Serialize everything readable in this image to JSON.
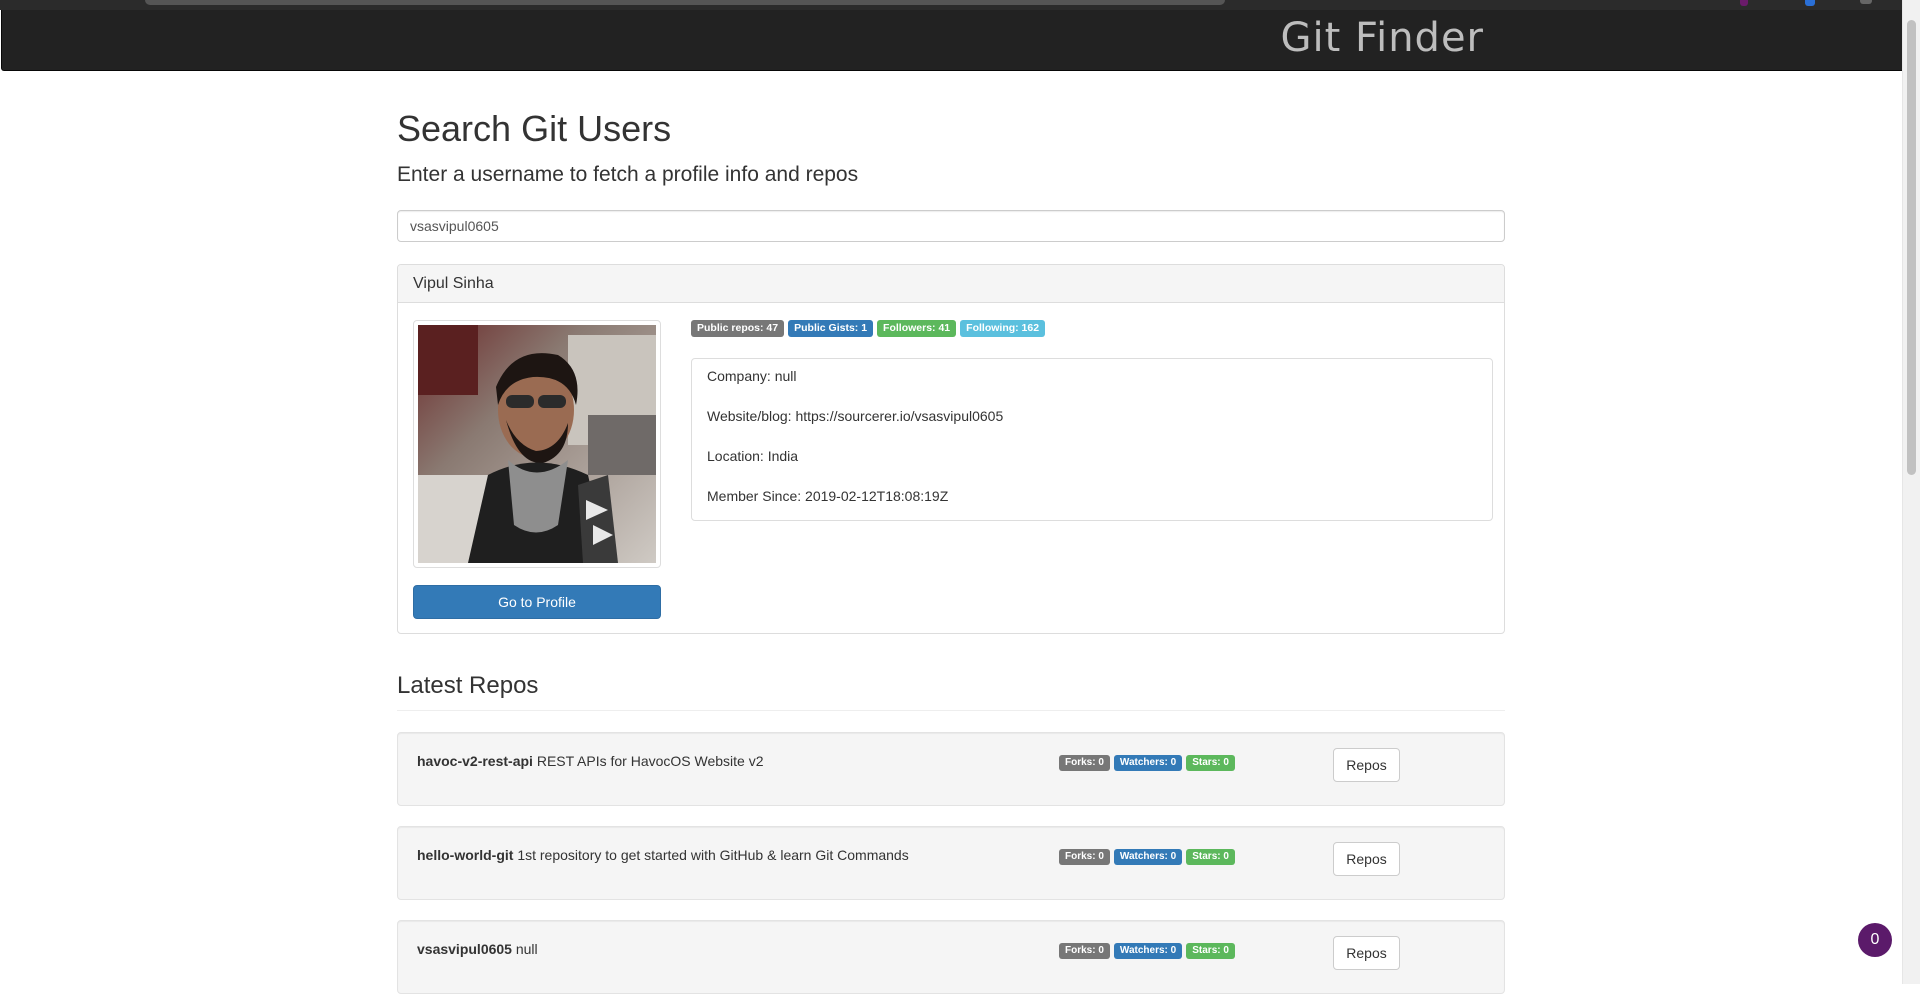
{
  "navbar": {
    "brand": "Git Finder"
  },
  "search": {
    "title": "Search Git Users",
    "subtitle": "Enter a username to fetch a profile info and repos",
    "value": "vsasvipul0605"
  },
  "profile": {
    "name": "Vipul Sinha",
    "badges": [
      {
        "label": "Public repos: 47",
        "color": "#777777"
      },
      {
        "label": "Public Gists: 1",
        "color": "#337ab7"
      },
      {
        "label": "Followers: 41",
        "color": "#5cb85c"
      },
      {
        "label": "Following: 162",
        "color": "#5bc0de"
      }
    ],
    "info": [
      "Company: null",
      "Website/blog: https://sourcerer.io/vsasvipul0605",
      "Location: India",
      "Member Since: 2019-02-12T18:08:19Z"
    ],
    "button_label": "Go to Profile"
  },
  "repos": {
    "title": "Latest Repos",
    "items": [
      {
        "name": "havoc-v2-rest-api",
        "description": "REST APIs for HavocOS Website v2",
        "forks": "Forks: 0",
        "watchers": "Watchers: 0",
        "stars": "Stars: 0",
        "button": "Repos"
      },
      {
        "name": "hello-world-git",
        "description": "1st repository to get started with GitHub & learn Git Commands",
        "forks": "Forks: 0",
        "watchers": "Watchers: 0",
        "stars": "Stars: 0",
        "button": "Repos"
      },
      {
        "name": "vsasvipul0605",
        "description": "null",
        "forks": "Forks: 0",
        "watchers": "Watchers: 0",
        "stars": "Stars: 0",
        "button": "Repos"
      }
    ]
  },
  "chat": {
    "count": "0"
  },
  "colors": {
    "navbar": "#222222",
    "primary": "#337ab7",
    "success": "#5cb85c",
    "info": "#5bc0de",
    "default_badge": "#777777"
  }
}
